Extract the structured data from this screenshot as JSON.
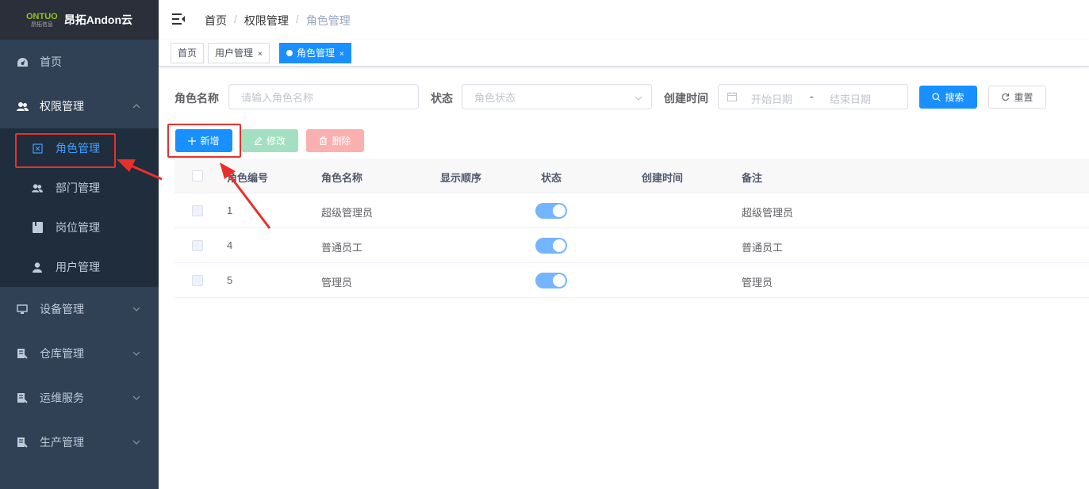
{
  "app": {
    "logo_top": "ONTUO",
    "logo_sub": "昂拓信息",
    "title": "昂拓Andon云"
  },
  "sidebar": {
    "items": [
      {
        "label": "首页"
      },
      {
        "label": "权限管理"
      },
      {
        "label": "设备管理"
      },
      {
        "label": "仓库管理"
      },
      {
        "label": "运维服务"
      },
      {
        "label": "生产管理"
      }
    ],
    "sub_items": [
      {
        "label": "角色管理"
      },
      {
        "label": "部门管理"
      },
      {
        "label": "岗位管理"
      },
      {
        "label": "用户管理"
      }
    ]
  },
  "breadcrumb": [
    "首页",
    "权限管理",
    "角色管理"
  ],
  "tags": [
    {
      "label": "首页"
    },
    {
      "label": "用户管理",
      "close": "×"
    },
    {
      "label": "角色管理",
      "close": "×"
    }
  ],
  "search": {
    "role_name_label": "角色名称",
    "role_name_placeholder": "请输入角色名称",
    "status_label": "状态",
    "status_placeholder": "角色状态",
    "created_label": "创建时间",
    "start_placeholder": "开始日期",
    "range_sep": "-",
    "end_placeholder": "结束日期",
    "search_button": "搜索",
    "reset_button": "重置"
  },
  "toolbar": {
    "add": "新增",
    "edit": "修改",
    "delete": "删除"
  },
  "table": {
    "columns": [
      "角色编号",
      "角色名称",
      "显示顺序",
      "状态",
      "创建时间",
      "备注"
    ],
    "rows": [
      {
        "id": "1",
        "name": "超级管理员",
        "order": "",
        "status_on": true,
        "created": "",
        "remark": "超级管理员"
      },
      {
        "id": "4",
        "name": "普通员工",
        "order": "",
        "status_on": true,
        "created": "",
        "remark": "普通员工"
      },
      {
        "id": "5",
        "name": "管理员",
        "order": "",
        "status_on": true,
        "created": "",
        "remark": "管理员"
      }
    ]
  },
  "colors": {
    "sidebar_bg": "#304156",
    "submenu_bg": "#1f2d3d",
    "primary": "#1890ff",
    "highlight": "#e8302a"
  }
}
